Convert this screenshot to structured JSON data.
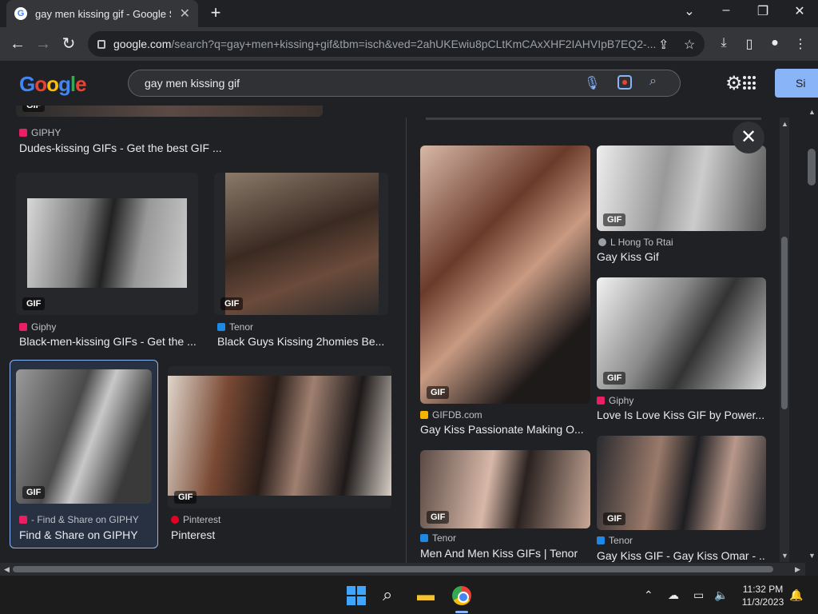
{
  "browser": {
    "tab_title": "gay men kissing gif - Google Sea",
    "tab_favicon": "G",
    "url_host": "google.com",
    "url_rest": "/search?q=gay+men+kissing+gif&tbm=isch&ved=2ahUKEwiu8pCLtKmCAxXHF2IAHVIpB7EQ2-..."
  },
  "search": {
    "query": "gay men kissing gif",
    "logo": "Google",
    "signin_label": "Si"
  },
  "grid": [
    {
      "source": "GIPHY",
      "caption": "Dudes-kissing GIFs - Get the best GIF ...",
      "source_color": "#e91e63"
    },
    {
      "source": "Giphy",
      "caption": "Black-men-kissing GIFs - Get the ...",
      "source_color": "#e91e63"
    },
    {
      "source": "Tenor",
      "caption": "Black Guys Kissing 2homies Be...",
      "source_color": "#1e88e5"
    },
    {
      "source": "- Find & Share on GIPHY",
      "caption": "Find & Share on GIPHY",
      "source_color": "#e91e63"
    },
    {
      "source": "Pinterest",
      "caption": "Pinterest",
      "source_color": "#e60023"
    }
  ],
  "panel": [
    {
      "source": "GIFDB.com",
      "caption": "Gay Kiss Passionate Making O...",
      "source_color": "#f4b400"
    },
    {
      "source": "L Hong To Rtai",
      "caption": "Gay Kiss Gif",
      "source_color": "#9aa0a6"
    },
    {
      "source": "Giphy",
      "caption": "Love Is Love Kiss GIF by Power...",
      "source_color": "#e91e63"
    },
    {
      "source": "Tenor",
      "caption": "Men And Men Kiss GIFs | Tenor",
      "source_color": "#1e88e5"
    },
    {
      "source": "Tenor",
      "caption": "Gay Kiss GIF - Gay Kiss Omar - ...",
      "source_color": "#1e88e5"
    }
  ],
  "gif_badge": "GIF",
  "taskbar": {
    "time": "11:32 PM",
    "date": "11/3/2023"
  }
}
